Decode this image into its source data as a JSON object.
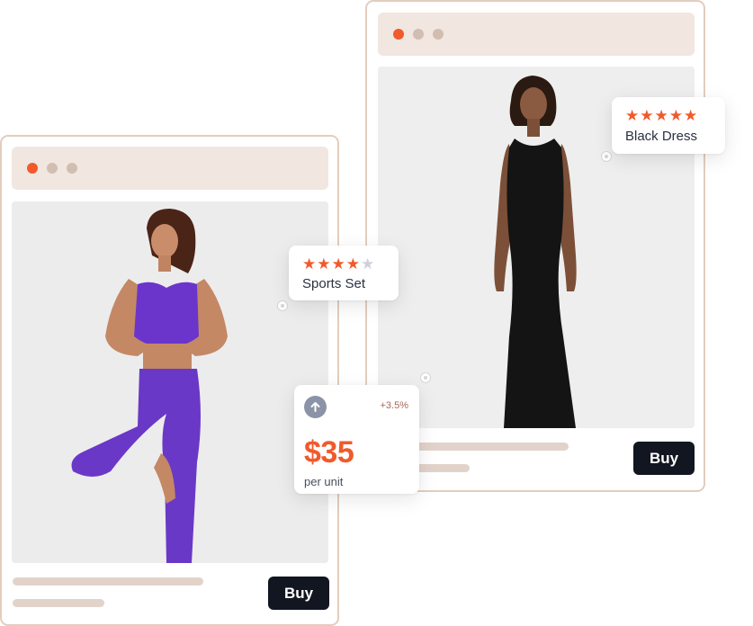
{
  "colors": {
    "accent": "#f15a2b",
    "dot_gray": "#d2bdb1",
    "button_bg": "#121621",
    "card_border": "#e3cdbd",
    "topbar_bg": "#f1e6e0",
    "skeleton": "#e2d3ca",
    "star_off": "#cdd1d8"
  },
  "back_card": {
    "buy_label": "Buy",
    "product_image": "woman-in-black-dress",
    "rating": {
      "stars_filled": 5,
      "stars_total": 5,
      "label": "Black Dress"
    }
  },
  "front_card": {
    "buy_label": "Buy",
    "product_image": "woman-in-purple-sports-set",
    "rating": {
      "stars_filled": 4,
      "stars_total": 5,
      "label": "Sports Set"
    }
  },
  "price_card": {
    "icon": "arrow-up-icon",
    "change": "+3.5%",
    "price": "$35",
    "unit": "per unit"
  }
}
